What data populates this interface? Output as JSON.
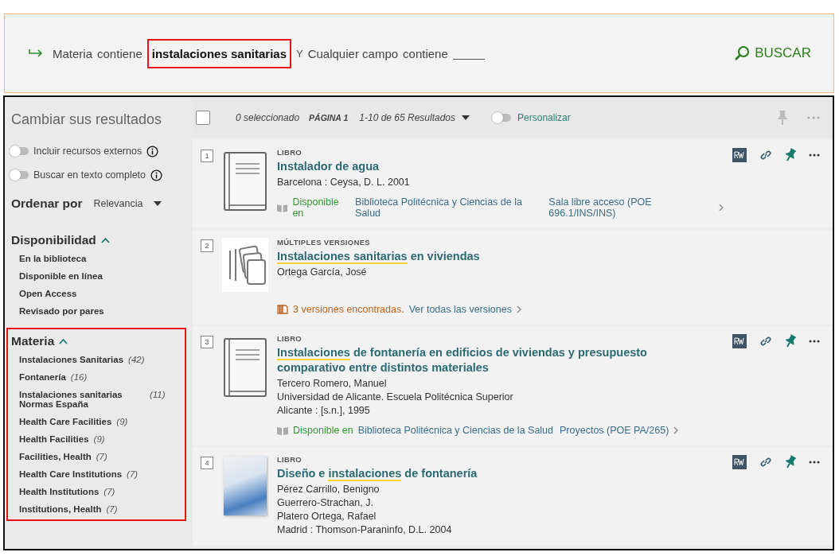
{
  "search": {
    "field_1": "Materia",
    "operator_1": "contiene",
    "value_1": "instalaciones sanitarias",
    "value_1_annotated": true,
    "connector": "Y",
    "field_2": "Cualquier campo",
    "operator_2": "contiene",
    "button": "BUSCAR"
  },
  "sidebar": {
    "title": "Cambiar sus resultados",
    "toggles": [
      {
        "label": "Incluir recursos externos",
        "on": false
      },
      {
        "label": "Buscar en texto completo",
        "on": false
      }
    ],
    "sort": {
      "label": "Ordenar por",
      "value": "Relevancia"
    },
    "facets": [
      {
        "title": "Disponibilidad",
        "expanded": true,
        "annotated": false,
        "items": [
          {
            "label": "En la biblioteca"
          },
          {
            "label": "Disponible en línea"
          },
          {
            "label": "Open Access"
          },
          {
            "label": "Revisado por pares"
          }
        ]
      },
      {
        "title": "Materia",
        "expanded": true,
        "annotated": true,
        "items": [
          {
            "label": "Instalaciones Sanitarias",
            "count": "(42)"
          },
          {
            "label": "Fontanería",
            "count": "(16)"
          },
          {
            "label": "Instalaciones sanitarias Normas España",
            "count": "(11)"
          },
          {
            "label": "Health Care Facilities",
            "count": "(9)"
          },
          {
            "label": "Health Facilities",
            "count": "(9)"
          },
          {
            "label": "Facilities, Health",
            "count": "(7)"
          },
          {
            "label": "Health Care Institutions",
            "count": "(7)"
          },
          {
            "label": "Health Institutions",
            "count": "(7)"
          },
          {
            "label": "Institutions, Health",
            "count": "(7)"
          }
        ]
      }
    ]
  },
  "toolbar": {
    "select_all_checked": false,
    "selected_count": "0 seleccionado",
    "page": "PÁGINA 1",
    "results": "1-10 de 65 Resultados",
    "personalize": {
      "label": "Personalizar",
      "on": false
    }
  },
  "results": [
    {
      "number": "1",
      "kind": "book",
      "type": "LIBRO",
      "title": [
        {
          "text": "Instalador de agua",
          "highlight": false
        }
      ],
      "lines": [
        "Barcelona : Ceysa, D. L. 2001"
      ],
      "availability": {
        "status": "Disponible en",
        "location": "Biblioteca Politécnica y Ciencias de la Salud",
        "shelf": "Sala libre acceso (POE 696.1/INS/INS)"
      }
    },
    {
      "number": "2",
      "kind": "versions",
      "type": "MÚLTIPLES VERSIONES",
      "title": [
        {
          "text": "Instalaciones sanitarias",
          "highlight": true
        },
        {
          "text": " en viviendas",
          "highlight": false
        }
      ],
      "lines": [
        "Ortega García, José"
      ],
      "versions": {
        "found": "3 versiones encontradas.",
        "link": "Ver todas las versiones"
      }
    },
    {
      "number": "3",
      "kind": "book",
      "type": "LIBRO",
      "title": [
        {
          "text": "Instalaciones",
          "highlight": true
        },
        {
          "text": " de fontanería en edificios de viviendas y presupuesto comparativo entre distintos materiales",
          "highlight": false
        }
      ],
      "lines": [
        "Tercero Romero, Manuel",
        "Universidad de Alicante. Escuela Politécnica Superior",
        "Alicante : [s.n.], 1995"
      ],
      "availability": {
        "status": "Disponible en",
        "location": "Biblioteca Politécnica y Ciencias de la Salud",
        "shelf": "Proyectos (POE PA/265)"
      }
    },
    {
      "number": "4",
      "kind": "cover",
      "type": "LIBRO",
      "title": [
        {
          "text": "Diseño e ",
          "highlight": false
        },
        {
          "text": "instalaciones",
          "highlight": true
        },
        {
          "text": " de fontanería",
          "highlight": false
        }
      ],
      "lines": [
        "Pérez Carrillo, Benigno",
        "Guerrero-Strachan, J.",
        "Platero Ortega, Rafael",
        "Madrid : Thomson-Paraninfo, D.L. 2004"
      ]
    }
  ]
}
